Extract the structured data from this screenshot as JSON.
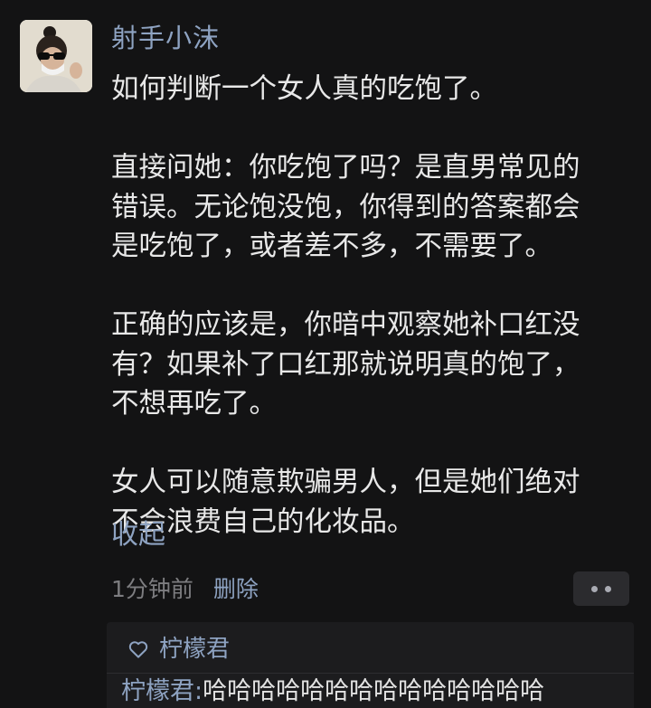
{
  "comment": {
    "username": "射手小沫",
    "paragraphs": [
      "如何判断一个女人真的吃饱了。",
      "直接问她：你吃饱了吗？是直男常见的\n错误。无论饱没饱，你得到的答案都会\n是吃饱了，或者差不多，不需要了。",
      "正确的应该是，你暗中观察她补口红没\n有？如果补了口红那就说明真的饱了，\n不想再吃了。",
      "女人可以随意欺骗男人，但是她们绝对\n不会浪费自己的化妆品。"
    ],
    "collapse_label": "收起",
    "timestamp": "1分钟前",
    "delete_label": "删除",
    "more_icon": "more-dots-icon"
  },
  "reply_box": {
    "like_icon": "heart-outline-icon",
    "liker": "柠檬君",
    "reply_author": "柠檬君:",
    "reply_text": "哈哈哈哈哈哈哈哈哈哈哈哈哈哈"
  },
  "colors": {
    "background": "#131314",
    "link_blue": "#8ea3c2",
    "body_text": "#e8e8e8",
    "meta_gray": "#7d7d80"
  }
}
